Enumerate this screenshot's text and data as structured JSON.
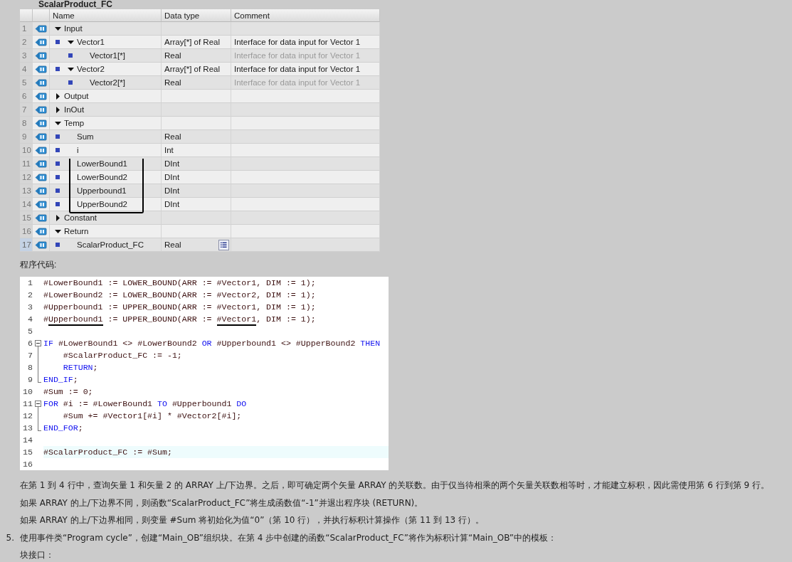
{
  "interface": {
    "title": "ScalarProduct_FC",
    "columns": [
      "Name",
      "Data type",
      "Comment"
    ],
    "rows": [
      {
        "number": "1",
        "name": "Input",
        "expanded": true,
        "selected": false,
        "marked": false,
        "children": [
          {
            "number": "2",
            "name": "Vector1",
            "data_type": "Array[*] of Real",
            "comment": "Interface for data input for Vector 1",
            "dimmed": false,
            "expanded": true,
            "selected": false,
            "marked": false,
            "children": [
              {
                "number": "3",
                "name": "Vector1[*]",
                "data_type": "Real",
                "comment": "Interface for data input for Vector 1",
                "dimmed": true,
                "selected": false,
                "marked": false
              }
            ]
          },
          {
            "number": "4",
            "name": "Vector2",
            "data_type": "Array[*] of Real",
            "comment": "Interface for data input for Vector 1",
            "dimmed": false,
            "expanded": true,
            "selected": false,
            "marked": false,
            "children": [
              {
                "number": "5",
                "name": "Vector2[*]",
                "data_type": "Real",
                "comment": "Interface for data input for Vector 1",
                "dimmed": true,
                "selected": false,
                "marked": false
              }
            ]
          }
        ]
      },
      {
        "number": "6",
        "name": "Output",
        "expanded": false,
        "selected": false,
        "marked": false
      },
      {
        "number": "7",
        "name": "InOut",
        "expanded": false,
        "selected": false,
        "marked": false
      },
      {
        "number": "8",
        "name": "Temp",
        "expanded": true,
        "selected": false,
        "marked": false,
        "children": [
          {
            "number": "9",
            "name": "Sum",
            "data_type": "Real",
            "selected": false,
            "marked": false
          },
          {
            "number": "10",
            "name": "i",
            "data_type": "Int",
            "selected": false,
            "marked": false
          },
          {
            "number": "11",
            "name": "LowerBound1",
            "data_type": "DInt",
            "selected": false,
            "marked": true
          },
          {
            "number": "12",
            "name": "LowerBound2",
            "data_type": "DInt",
            "selected": false,
            "marked": true
          },
          {
            "number": "13",
            "name": "Upperbound1",
            "data_type": "DInt",
            "selected": false,
            "marked": true
          },
          {
            "number": "14",
            "name": "UpperBound2",
            "data_type": "DInt",
            "selected": false,
            "marked": true
          }
        ]
      },
      {
        "number": "15",
        "name": "Constant",
        "expanded": false,
        "selected": false,
        "marked": false
      },
      {
        "number": "16",
        "name": "Return",
        "expanded": true,
        "selected": false,
        "marked": false,
        "children": [
          {
            "number": "17",
            "name": "ScalarProduct_FC",
            "data_type": "Real",
            "selected": true,
            "marked": false
          }
        ]
      }
    ]
  },
  "code_heading": "程序代码:",
  "code": {
    "lines": [
      {
        "number": "1",
        "kind": "plain",
        "highlighted": false,
        "segments": [
          {
            "text": "#LowerBound1 := LOWER_BOUND(ARR := #Vector1, DIM := 1);",
            "kind": "plain",
            "marked": false
          }
        ]
      },
      {
        "number": "2",
        "kind": "plain",
        "highlighted": false,
        "segments": [
          {
            "text": "#LowerBound2 := LOWER_BOUND(ARR := #Vector2, DIM := 1);",
            "kind": "plain",
            "marked": false
          }
        ]
      },
      {
        "number": "3",
        "kind": "plain",
        "highlighted": false,
        "segments": [
          {
            "text": "#Upperbound1 := UPPER_BOUND(ARR := #Vector1, DIM := 1);",
            "kind": "plain",
            "marked": false
          }
        ]
      },
      {
        "number": "4",
        "kind": "plain",
        "highlighted": false,
        "segments": [
          {
            "text": "#",
            "kind": "plain",
            "marked": false
          },
          {
            "text": "Upperbound1",
            "kind": "plain",
            "marked": true
          },
          {
            "text": " := UPPER_BOUND(ARR := ",
            "kind": "plain",
            "marked": false
          },
          {
            "text": "#Vector1",
            "kind": "plain",
            "marked": true
          },
          {
            "text": ", DIM := 1);",
            "kind": "plain",
            "marked": false
          }
        ]
      },
      {
        "number": "5",
        "kind": "plain",
        "highlighted": false
      },
      {
        "number": "6",
        "kind": "opener",
        "highlighted": false,
        "segments": [
          {
            "text": "IF",
            "kind": "keyword",
            "marked": false
          },
          {
            "text": " #LowerBound1 <> #LowerBound2 ",
            "kind": "plain",
            "marked": false
          },
          {
            "text": "OR",
            "kind": "keyword",
            "marked": false
          },
          {
            "text": " #Upperbound1 <> #UpperBound2 ",
            "kind": "plain",
            "marked": false
          },
          {
            "text": "THEN",
            "kind": "keyword",
            "marked": false
          }
        ]
      },
      {
        "number": "7",
        "kind": "inner",
        "highlighted": false,
        "segments": [
          {
            "text": "    #ScalarProduct_FC := -1;",
            "kind": "plain",
            "marked": false
          }
        ]
      },
      {
        "number": "8",
        "kind": "inner",
        "highlighted": false,
        "segments": [
          {
            "text": "    RETURN",
            "kind": "keyword",
            "marked": false
          },
          {
            "text": ";",
            "kind": "plain",
            "marked": false
          }
        ]
      },
      {
        "number": "9",
        "kind": "closer",
        "highlighted": false,
        "segments": [
          {
            "text": "END_IF",
            "kind": "keyword",
            "marked": false
          },
          {
            "text": ";",
            "kind": "plain",
            "marked": false
          }
        ]
      },
      {
        "number": "10",
        "kind": "plain",
        "highlighted": false,
        "segments": [
          {
            "text": "#Sum := 0;",
            "kind": "plain",
            "marked": false
          }
        ]
      },
      {
        "number": "11",
        "kind": "opener",
        "highlighted": false,
        "segments": [
          {
            "text": "FOR",
            "kind": "keyword",
            "marked": false
          },
          {
            "text": " #i := #LowerBound1 ",
            "kind": "plain",
            "marked": false
          },
          {
            "text": "TO",
            "kind": "keyword",
            "marked": false
          },
          {
            "text": " #Upperbound1 ",
            "kind": "plain",
            "marked": false
          },
          {
            "text": "DO",
            "kind": "keyword",
            "marked": false
          }
        ]
      },
      {
        "number": "12",
        "kind": "inner",
        "highlighted": false,
        "segments": [
          {
            "text": "    #Sum += #Vector1[#i] * #Vector2[#i];",
            "kind": "plain",
            "marked": false
          }
        ]
      },
      {
        "number": "13",
        "kind": "closer",
        "highlighted": false,
        "segments": [
          {
            "text": "END_FOR",
            "kind": "keyword",
            "marked": false
          },
          {
            "text": ";",
            "kind": "plain",
            "marked": false
          }
        ]
      },
      {
        "number": "14",
        "kind": "plain",
        "highlighted": false
      },
      {
        "number": "15",
        "kind": "plain",
        "highlighted": true,
        "segments": [
          {
            "text": "#ScalarProduct_FC := #Sum;",
            "kind": "plain",
            "marked": false
          }
        ]
      },
      {
        "number": "16",
        "kind": "plain",
        "highlighted": false
      }
    ]
  },
  "paragraphs": [
    {
      "text": "在第 1 到 4 行中，查询矢量 1 和矢量 2 的 ARRAY 上/下边界。之后，即可确定两个矢量 ARRAY 的关联数。由于仅当待相乘的两个矢量关联数相等时，才能建立标积，因此需使用第 6 行到第 9 行。"
    },
    {
      "text": "如果 ARRAY 的上/下边界不同，则函数“ScalarProduct_FC”将生成函数值“-1”并退出程序块 (RETURN)。"
    },
    {
      "text": "如果 ARRAY 的上/下边界相同，则变量 #Sum 将初始化为值“0”（第 10 行），并执行标积计算操作（第 11 到 13 行）。"
    },
    {
      "marker": "5.",
      "text": "使用事件类“Program cycle”，创建“Main_OB”组织块。在第 4 步中创建的函数“ScalarProduct_FC”将作为标积计算“Main_OB”中的模板："
    },
    {
      "text": "块接口："
    }
  ]
}
